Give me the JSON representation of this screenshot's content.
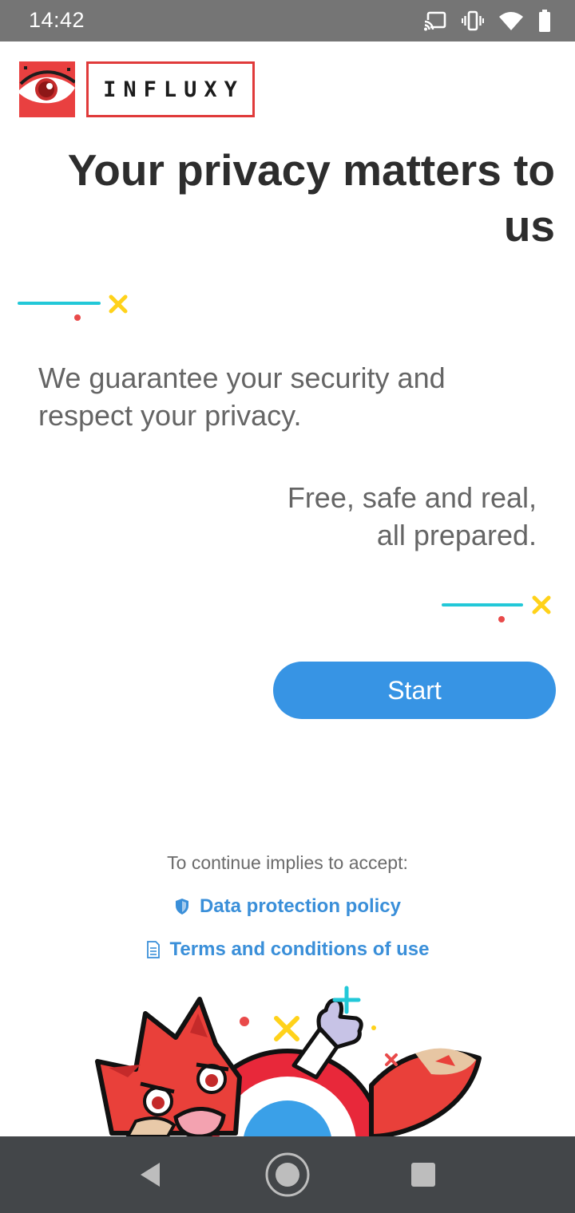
{
  "status_bar": {
    "time": "14:42",
    "icons": [
      "cast-icon",
      "vibrate-icon",
      "wifi-icon",
      "battery-icon"
    ]
  },
  "brand": {
    "name": "INFLUXY",
    "color": "#e94040"
  },
  "headline": "Your privacy matters to us",
  "body": {
    "guarantee": "We guarantee your security and respect your privacy.",
    "tagline_line1": "Free, safe and real,",
    "tagline_line2": "all prepared."
  },
  "start_button": {
    "label": "Start",
    "color": "#3794e4"
  },
  "legal": {
    "accept_text": "To continue implies to accept:",
    "privacy_link": "Data protection policy",
    "privacy_icon": "shield-icon",
    "terms_link": "Terms and conditions of use",
    "terms_icon": "document-icon",
    "link_color": "#3a8fd9"
  },
  "decor_colors": {
    "cyan": "#22c8d8",
    "yellow": "#ffd21a",
    "red": "#e94a4a"
  },
  "nav_bar": {
    "buttons": [
      "back-icon",
      "home-icon",
      "recents-icon"
    ]
  }
}
